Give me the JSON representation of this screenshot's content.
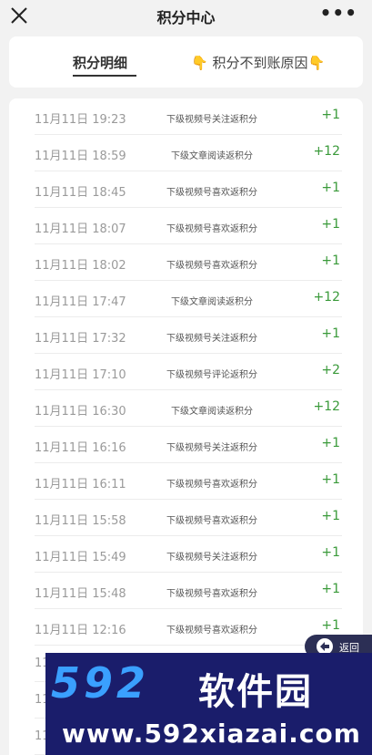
{
  "header": {
    "title": "积分中心",
    "close_icon": "close-icon",
    "more_label": "•••"
  },
  "tabs": {
    "active": "积分明细",
    "reason": "👇 积分不到账原因👇"
  },
  "records": [
    {
      "time": "11月11日 19:23",
      "desc": "下级视频号关注返积分",
      "points": "+1"
    },
    {
      "time": "11月11日 18:59",
      "desc": "下级文章阅读返积分",
      "points": "+12"
    },
    {
      "time": "11月11日 18:45",
      "desc": "下级视频号喜欢返积分",
      "points": "+1"
    },
    {
      "time": "11月11日 18:07",
      "desc": "下级视频号喜欢返积分",
      "points": "+1"
    },
    {
      "time": "11月11日 18:02",
      "desc": "下级视频号喜欢返积分",
      "points": "+1"
    },
    {
      "time": "11月11日 17:47",
      "desc": "下级文章阅读返积分",
      "points": "+12"
    },
    {
      "time": "11月11日 17:32",
      "desc": "下级视频号关注返积分",
      "points": "+1"
    },
    {
      "time": "11月11日 17:10",
      "desc": "下级视频号评论返积分",
      "points": "+2"
    },
    {
      "time": "11月11日 16:30",
      "desc": "下级文章阅读返积分",
      "points": "+12"
    },
    {
      "time": "11月11日 16:16",
      "desc": "下级视频号关注返积分",
      "points": "+1"
    },
    {
      "time": "11月11日 16:11",
      "desc": "下级视频号喜欢返积分",
      "points": "+1"
    },
    {
      "time": "11月11日 15:58",
      "desc": "下级视频号喜欢返积分",
      "points": "+1"
    },
    {
      "time": "11月11日 15:49",
      "desc": "下级视频号关注返积分",
      "points": "+1"
    },
    {
      "time": "11月11日 15:48",
      "desc": "下级视频号喜欢返积分",
      "points": "+1"
    },
    {
      "time": "11月11日 12:16",
      "desc": "下级视频号喜欢返积分",
      "points": "+1"
    },
    {
      "time": "11",
      "desc": "",
      "points": ""
    },
    {
      "time": "11",
      "desc": "",
      "points": ""
    },
    {
      "time": "11",
      "desc": "",
      "points": ""
    }
  ],
  "back_button": {
    "label": "返回",
    "icon": "back-arrow-icon"
  },
  "watermark": {
    "logo": "592",
    "name": "软件园",
    "url": "www.592xiazai.com"
  },
  "colors": {
    "points": "#3a9a3a",
    "time": "#9a9a9a",
    "background": "#f2f2f2",
    "watermark_bg": "#1a1d6b",
    "back_pill": "#2c2f55"
  }
}
